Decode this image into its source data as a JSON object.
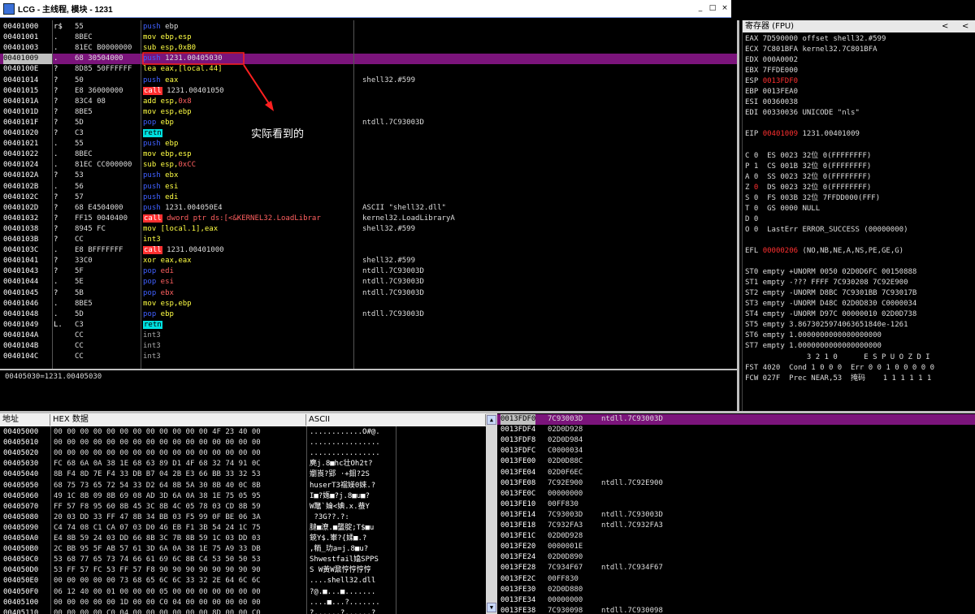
{
  "window": {
    "title": "LCG - 主线程, 模块 - 1231",
    "min": "_",
    "max": "□",
    "close": "×"
  },
  "annotation": "实际看到的",
  "accent": "#7b147b",
  "disasm": [
    {
      "addr": "00401000",
      "bp": "r$",
      "hex": "55",
      "asm": [
        [
          "push",
          "p"
        ],
        [
          " ebp",
          ""
        ]
      ],
      "comment": ""
    },
    {
      "addr": "00401001",
      "bp": ".",
      "hex": "8BEC",
      "asm": [
        [
          "mov ebp,esp",
          "n"
        ]
      ],
      "comment": ""
    },
    {
      "addr": "00401003",
      "bp": ".",
      "hex": "81EC B0000000",
      "asm": [
        [
          "sub esp,0xB0",
          "n"
        ]
      ],
      "comment": ""
    },
    {
      "addr": "00401009",
      "bp": ".",
      "hex": "68 30504000",
      "asm": [
        [
          "push",
          "p"
        ],
        [
          " 1231.00405030",
          ""
        ]
      ],
      "comment": "",
      "sel": true
    },
    {
      "addr": "0040100E",
      "bp": "?",
      "hex": "8D85 50FFFFFF",
      "asm": [
        [
          "lea eax,[local.44]",
          "n"
        ]
      ],
      "comment": ""
    },
    {
      "addr": "00401014",
      "bp": "?",
      "hex": "50",
      "asm": [
        [
          "push",
          "p"
        ],
        [
          " eax",
          "n"
        ]
      ],
      "comment": "shell32.#599"
    },
    {
      "addr": "00401015",
      "bp": "?",
      "hex": "E8 36000000",
      "asm": [
        [
          "call",
          "call"
        ],
        [
          " 1231.00401050",
          ""
        ]
      ],
      "comment": ""
    },
    {
      "addr": "0040101A",
      "bp": "?",
      "hex": "83C4 08",
      "asm": [
        [
          "add esp,",
          "n"
        ],
        [
          "0x8",
          "h"
        ]
      ],
      "comment": ""
    },
    {
      "addr": "0040101D",
      "bp": "?",
      "hex": "8BE5",
      "asm": [
        [
          "mov esp,ebp",
          "n"
        ]
      ],
      "comment": ""
    },
    {
      "addr": "0040101F",
      "bp": "?",
      "hex": "5D",
      "asm": [
        [
          "pop",
          "p"
        ],
        [
          " ebp",
          "n"
        ]
      ],
      "comment": "ntdll.7C93003D"
    },
    {
      "addr": "00401020",
      "bp": "?",
      "hex": "C3",
      "asm": [
        [
          "retn",
          "retn"
        ]
      ],
      "comment": ""
    },
    {
      "addr": "00401021",
      "bp": ".",
      "hex": "55",
      "asm": [
        [
          "push",
          "p"
        ],
        [
          " ebp",
          "n"
        ]
      ],
      "comment": ""
    },
    {
      "addr": "00401022",
      "bp": ".",
      "hex": "8BEC",
      "asm": [
        [
          "mov ebp,esp",
          "n"
        ]
      ],
      "comment": ""
    },
    {
      "addr": "00401024",
      "bp": ".",
      "hex": "81EC CC000000",
      "asm": [
        [
          "sub esp,",
          "n"
        ],
        [
          "0xCC",
          "h"
        ]
      ],
      "comment": ""
    },
    {
      "addr": "0040102A",
      "bp": "?",
      "hex": "53",
      "asm": [
        [
          "push",
          "p"
        ],
        [
          " ebx",
          "n"
        ]
      ],
      "comment": ""
    },
    {
      "addr": "0040102B",
      "bp": ".",
      "hex": "56",
      "asm": [
        [
          "push",
          "p"
        ],
        [
          " esi",
          "n"
        ]
      ],
      "comment": ""
    },
    {
      "addr": "0040102C",
      "bp": "?",
      "hex": "57",
      "asm": [
        [
          "push",
          "p"
        ],
        [
          " edi",
          "n"
        ]
      ],
      "comment": ""
    },
    {
      "addr": "0040102D",
      "bp": "?",
      "hex": "68 E4504000",
      "asm": [
        [
          "push",
          "p"
        ],
        [
          " 1231.004050E4",
          ""
        ]
      ],
      "comment": "ASCII \"shell32.dll\""
    },
    {
      "addr": "00401032",
      "bp": "?",
      "hex": "FF15 0040400",
      "asm": [
        [
          "call",
          "call"
        ],
        [
          " dword ptr ds:[<&KERNEL32.LoadLibrar",
          "h"
        ]
      ],
      "comment": "kernel32.LoadLibraryA"
    },
    {
      "addr": "00401038",
      "bp": "?",
      "hex": "8945 FC",
      "asm": [
        [
          "mov [local.1],eax",
          "n"
        ]
      ],
      "comment": "shell32.#599"
    },
    {
      "addr": "0040103B",
      "bp": "?",
      "hex": "CC",
      "asm": [
        [
          "int3",
          "n"
        ]
      ],
      "comment": ""
    },
    {
      "addr": "0040103C",
      "bp": ".",
      "hex": "E8 BFFFFFFF",
      "asm": [
        [
          "call",
          "call"
        ],
        [
          " 1231.00401000",
          ""
        ]
      ],
      "comment": ""
    },
    {
      "addr": "00401041",
      "bp": "?",
      "hex": "33C0",
      "asm": [
        [
          "xor eax,eax",
          "n"
        ]
      ],
      "comment": "shell32.#599"
    },
    {
      "addr": "00401043",
      "bp": "?",
      "hex": "5F",
      "asm": [
        [
          "pop",
          "p"
        ],
        [
          " edi",
          "h"
        ]
      ],
      "comment": "ntdll.7C93003D"
    },
    {
      "addr": "00401044",
      "bp": ".",
      "hex": "5E",
      "asm": [
        [
          "pop",
          "p"
        ],
        [
          " esi",
          "h"
        ]
      ],
      "comment": "ntdll.7C93003D"
    },
    {
      "addr": "00401045",
      "bp": "?",
      "hex": "5B",
      "asm": [
        [
          "pop",
          "p"
        ],
        [
          " ebx",
          "h"
        ]
      ],
      "comment": "ntdll.7C93003D"
    },
    {
      "addr": "00401046",
      "bp": ".",
      "hex": "8BE5",
      "asm": [
        [
          "mov esp,ebp",
          "n"
        ]
      ],
      "comment": ""
    },
    {
      "addr": "00401048",
      "bp": ".",
      "hex": "5D",
      "asm": [
        [
          "pop",
          "p"
        ],
        [
          " ebp",
          "n"
        ]
      ],
      "comment": "ntdll.7C93003D"
    },
    {
      "addr": "00401049",
      "bp": "L.",
      "hex": "C3",
      "asm": [
        [
          "retn",
          "retn"
        ]
      ],
      "comment": ""
    },
    {
      "addr": "0040104A",
      "bp": "",
      "hex": "CC",
      "asm": [
        [
          "int3",
          "g"
        ]
      ],
      "comment": ""
    },
    {
      "addr": "0040104B",
      "bp": "",
      "hex": "CC",
      "asm": [
        [
          "int3",
          "g"
        ]
      ],
      "comment": ""
    },
    {
      "addr": "0040104C",
      "bp": "",
      "hex": "CC",
      "asm": [
        [
          "int3",
          "g"
        ]
      ],
      "comment": ""
    }
  ],
  "info": "00405030=1231.00405030",
  "registers": {
    "title": "寄存器 (FPU)",
    "nav": [
      "<",
      "<"
    ],
    "lines": [
      [
        [
          "EAX 7D590000 offset shell32.#599",
          ""
        ]
      ],
      [
        [
          "ECX 7C801BFA kernel32.7C801BFA",
          ""
        ]
      ],
      [
        [
          "EDX 000A0002",
          ""
        ]
      ],
      [
        [
          "EBX 7FFDE000",
          ""
        ]
      ],
      [
        [
          "ESP ",
          ""
        ],
        [
          "0013FDF0",
          "red"
        ]
      ],
      [
        [
          "EBP 0013FEA0",
          ""
        ]
      ],
      [
        [
          "ESI 00360038",
          ""
        ]
      ],
      [
        [
          "EDI 00330036 UNICODE \"nls\"",
          ""
        ]
      ],
      [
        [
          "",
          ""
        ]
      ],
      [
        [
          "EIP ",
          ""
        ],
        [
          "00401009",
          "red"
        ],
        [
          " 1231.00401009",
          ""
        ]
      ],
      [
        [
          "",
          ""
        ]
      ],
      [
        [
          "C 0  ES 0023 32位 0(FFFFFFFF)",
          ""
        ]
      ],
      [
        [
          "P 1  CS 001B 32位 0(FFFFFFFF)",
          ""
        ]
      ],
      [
        [
          "A 0  SS 0023 32位 0(FFFFFFFF)",
          ""
        ]
      ],
      [
        [
          "Z ",
          ""
        ],
        [
          "0",
          "red"
        ],
        [
          "  DS 0023 32位 0(FFFFFFFF)",
          ""
        ]
      ],
      [
        [
          "S 0  FS 003B 32位 7FFDD000(FFF)",
          ""
        ]
      ],
      [
        [
          "T 0  GS 0000 NULL",
          ""
        ]
      ],
      [
        [
          "D 0",
          ""
        ]
      ],
      [
        [
          "O 0  LastErr ERROR_SUCCESS (00000000)",
          ""
        ]
      ],
      [
        [
          "",
          ""
        ]
      ],
      [
        [
          "EFL ",
          ""
        ],
        [
          "00000206",
          "red"
        ],
        [
          " (NO,NB,NE,A,NS,PE,GE,G)",
          ""
        ]
      ],
      [
        [
          "",
          ""
        ]
      ],
      [
        [
          "ST0 empty +UNORM 0050 02D0D6FC 00150888",
          ""
        ]
      ],
      [
        [
          "ST1 empty -??? FFFF 7C930208 7C92E900",
          ""
        ]
      ],
      [
        [
          "ST2 empty -UNORM D8BC 7C9301BB 7C93017B",
          ""
        ]
      ],
      [
        [
          "ST3 empty -UNORM D48C 02D0D830 C0000034",
          ""
        ]
      ],
      [
        [
          "ST4 empty -UNORM D97C 00000010 02D0D738",
          ""
        ]
      ],
      [
        [
          "ST5 empty 3.8673025974063651840e-1261",
          ""
        ]
      ],
      [
        [
          "ST6 empty 1.0000000000000000000",
          ""
        ]
      ],
      [
        [
          "ST7 empty 1.0000000000000000000",
          ""
        ]
      ],
      [
        [
          "              3 2 1 0      E S P U O Z D I",
          ""
        ]
      ],
      [
        [
          "FST 4020  Cond 1 0 0 0  Err 0 0 1 0 0 0 0 0",
          ""
        ]
      ],
      [
        [
          "FCW 027F  Prec NEAR,53  掩码    1 1 1 1 1 1",
          ""
        ]
      ]
    ]
  },
  "hex": {
    "headers": [
      "地址",
      "HEX 数据",
      "ASCII"
    ],
    "rows": [
      [
        "00405000",
        "00 00 00 00 00 00 00 00 00 00 00 00 4F 23 40 00",
        "............O#@."
      ],
      [
        "00405010",
        "00 00 00 00 00 00 00 00 00 00 00 00 00 00 00 00",
        "................"
      ],
      [
        "00405020",
        "00 00 00 00 00 00 00 00 00 00 00 00 00 00 00 00",
        "................"
      ],
      [
        "00405030",
        "FC 68 6A 0A 38 1E 68 63 89 D1 4F 68 32 74 91 0C",
        "麂j.8■hc壮Oh2t?"
      ],
      [
        "00405040",
        "8B F4 8D 7E F4 33 DB B7 04 2B E3 66 BB 33 32 53",
        "嬼崀?郢 ·+鉬?2S"
      ],
      [
        "00405050",
        "68 75 73 65 72 54 33 D2 64 8B 5A 30 8B 40 0C 8B",
        "huserT3襠媄0婡.?"
      ],
      [
        "00405060",
        "49 1C 8B 09 8B 69 08 AD 3D 6A 0A 38 1E 75 05 95",
        "I■?嫕■?j.8■u■?"
      ],
      [
        "00405070",
        "FF 57 F8 95 60 8B 45 3C 8B 4C 05 78 03 CD 8B 59",
        "W鼈`婨<婰.x.蛬Y"
      ],
      [
        "00405080",
        "20 03 DD 33 FF 47 8B 34 BB 03 F5 99 0F BE 06 3A",
        " ?3G??.?:"
      ],
      [
        "00405090",
        "C4 74 08 C1 CA 07 03 D0 46 EB F1 3B 54 24 1C 75",
        "膖■潦.■蠪腚;T$■u"
      ],
      [
        "004050A0",
        "E4 8B 59 24 03 DD 66 8B 3C 7B 8B 59 1C 03 DD 03",
        "鋴Y$.輋?{媃■.?"
      ],
      [
        "004050B0",
        "2C BB 95 5F AB 57 61 3D 6A 0A 38 1E 75 A9 33 DB",
        ",粫_玏a=j.8■u?"
      ],
      [
        "004050C0",
        "53 68 77 65 73 74 66 61 69 6C 8B C4 53 50 50 53",
        "Shwestfail嬆SPPS"
      ],
      [
        "004050D0",
        "53 FF 57 FC 53 FF 57 F8 90 90 90 90 90 90 90 90",
        "S W黃W鼐悙悙悙悙"
      ],
      [
        "004050E0",
        "00 00 00 00 00 73 68 65 6C 6C 33 32 2E 64 6C 6C",
        "....shell32.dll"
      ],
      [
        "004050F0",
        "06 12 40 00 01 00 00 00 05 00 00 00 00 00 00 00",
        "?@.■...■......."
      ],
      [
        "00405100",
        "00 00 00 00 00 1D 00 00 C0 04 00 00 00 00 00 00",
        "....■...?......."
      ],
      [
        "00405110",
        "00 00 00 00 C0 04 00 00 00 00 00 00 8D 00 00 C0",
        "?......?......?"
      ]
    ]
  },
  "stack": [
    [
      "0013FDF0",
      "7C93003D",
      "ntdll.7C93003D"
    ],
    [
      "0013FDF4",
      "02D0D928",
      ""
    ],
    [
      "0013FDF8",
      "02D0D984",
      ""
    ],
    [
      "0013FDFC",
      "C0000034",
      ""
    ],
    [
      "0013FE00",
      "02D0D88C",
      ""
    ],
    [
      "0013FE04",
      "02D0F6EC",
      ""
    ],
    [
      "0013FE08",
      "7C92E900",
      "ntdll.7C92E900"
    ],
    [
      "0013FE0C",
      "00000000",
      ""
    ],
    [
      "0013FE10",
      "00FF830",
      ""
    ],
    [
      "0013FE14",
      "7C93003D",
      "ntdll.7C93003D"
    ],
    [
      "0013FE18",
      "7C932FA3",
      "ntdll.7C932FA3"
    ],
    [
      "0013FE1C",
      "02D0D928",
      ""
    ],
    [
      "0013FE20",
      "0000001E",
      ""
    ],
    [
      "0013FE24",
      "02D0D890",
      ""
    ],
    [
      "0013FE28",
      "7C934F67",
      "ntdll.7C934F67"
    ],
    [
      "0013FE2C",
      "00FF830",
      ""
    ],
    [
      "0013FE30",
      "02D0D880",
      ""
    ],
    [
      "0013FE34",
      "00000000",
      ""
    ],
    [
      "0013FE38",
      "7C930098",
      "ntdll.7C930098"
    ]
  ]
}
